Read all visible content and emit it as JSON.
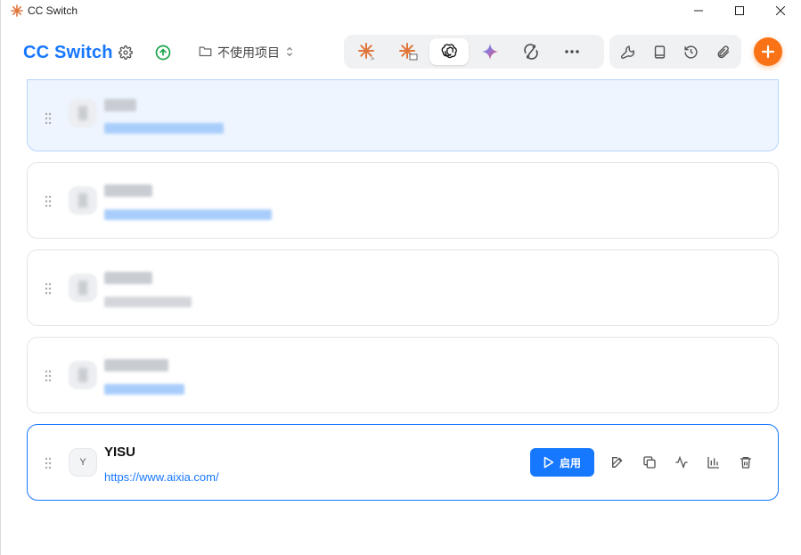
{
  "window": {
    "title": "CC Switch"
  },
  "header": {
    "brand": "CC Switch",
    "project_select_label": "不使用项目"
  },
  "app_tabs": [
    {
      "name": "claude-code",
      "active": false
    },
    {
      "name": "claude-desktop",
      "active": false
    },
    {
      "name": "openai-codex",
      "active": true
    },
    {
      "name": "gemini",
      "active": false
    },
    {
      "name": "sync",
      "active": false
    },
    {
      "name": "more",
      "active": false
    }
  ],
  "tools": [
    "wrench-icon",
    "book-icon",
    "history-icon",
    "paperclip-icon"
  ],
  "providers": [
    {
      "name": "",
      "url": "",
      "blurred": true
    },
    {
      "name": "",
      "url": "",
      "blurred": true
    },
    {
      "name": "",
      "url": "",
      "blurred": true
    },
    {
      "name": "",
      "url": "",
      "blurred": true
    },
    {
      "name": "YISU",
      "url": "https://www.aixia.com/",
      "avatar_letter": "Y",
      "blurred": false
    }
  ],
  "card_actions": {
    "enable_label": "启用"
  },
  "colors": {
    "brand": "#1677ff",
    "accent_add": "#f97316",
    "claude_orange": "#e0763c"
  }
}
